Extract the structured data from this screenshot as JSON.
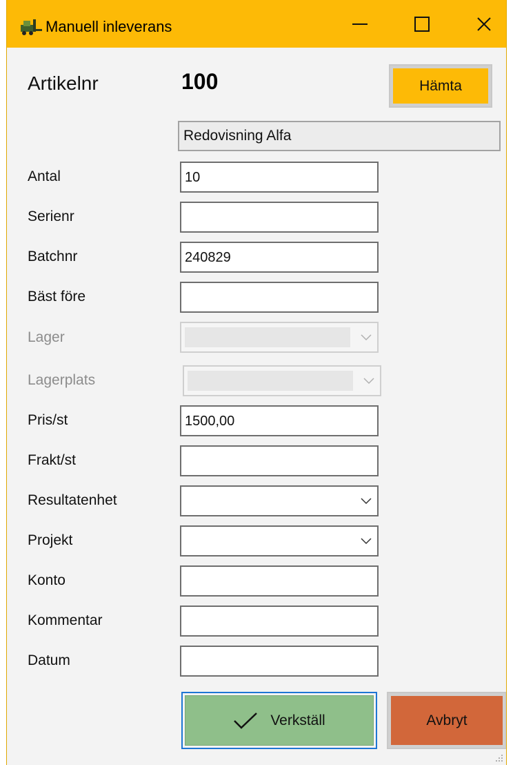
{
  "window": {
    "title": "Manuell inleverans",
    "icon": "forklift-icon",
    "controls": [
      "minimize-icon",
      "maximize-icon",
      "close-icon"
    ]
  },
  "article": {
    "label": "Artikelnr",
    "number": "100",
    "fetch_button": "Hämta",
    "description": "Redovisning Alfa"
  },
  "fields": {
    "antal": {
      "label": "Antal",
      "value": "10"
    },
    "serienr": {
      "label": "Serienr",
      "value": ""
    },
    "batchnr": {
      "label": "Batchnr",
      "value": "240829"
    },
    "bast_fore": {
      "label": "Bäst före",
      "value": ""
    },
    "lager": {
      "label": "Lager",
      "value": ""
    },
    "lagerplats": {
      "label": "Lagerplats",
      "value": ""
    },
    "pris": {
      "label": "Pris/st",
      "value": "1500,00"
    },
    "frakt": {
      "label": "Frakt/st",
      "value": ""
    },
    "resultatenhet": {
      "label": "Resultatenhet",
      "value": ""
    },
    "projekt": {
      "label": "Projekt",
      "value": ""
    },
    "konto": {
      "label": "Konto",
      "value": ""
    },
    "kommentar": {
      "label": "Kommentar",
      "value": ""
    },
    "datum": {
      "label": "Datum",
      "value": ""
    }
  },
  "actions": {
    "apply": "Verkställ",
    "cancel": "Avbryt"
  },
  "colors": {
    "titlebar": "#fdba06",
    "fetch_button": "#fdba06",
    "apply_button": "#8fbf8a",
    "cancel_button": "#d2673a",
    "focus_border": "#1e76d4"
  }
}
